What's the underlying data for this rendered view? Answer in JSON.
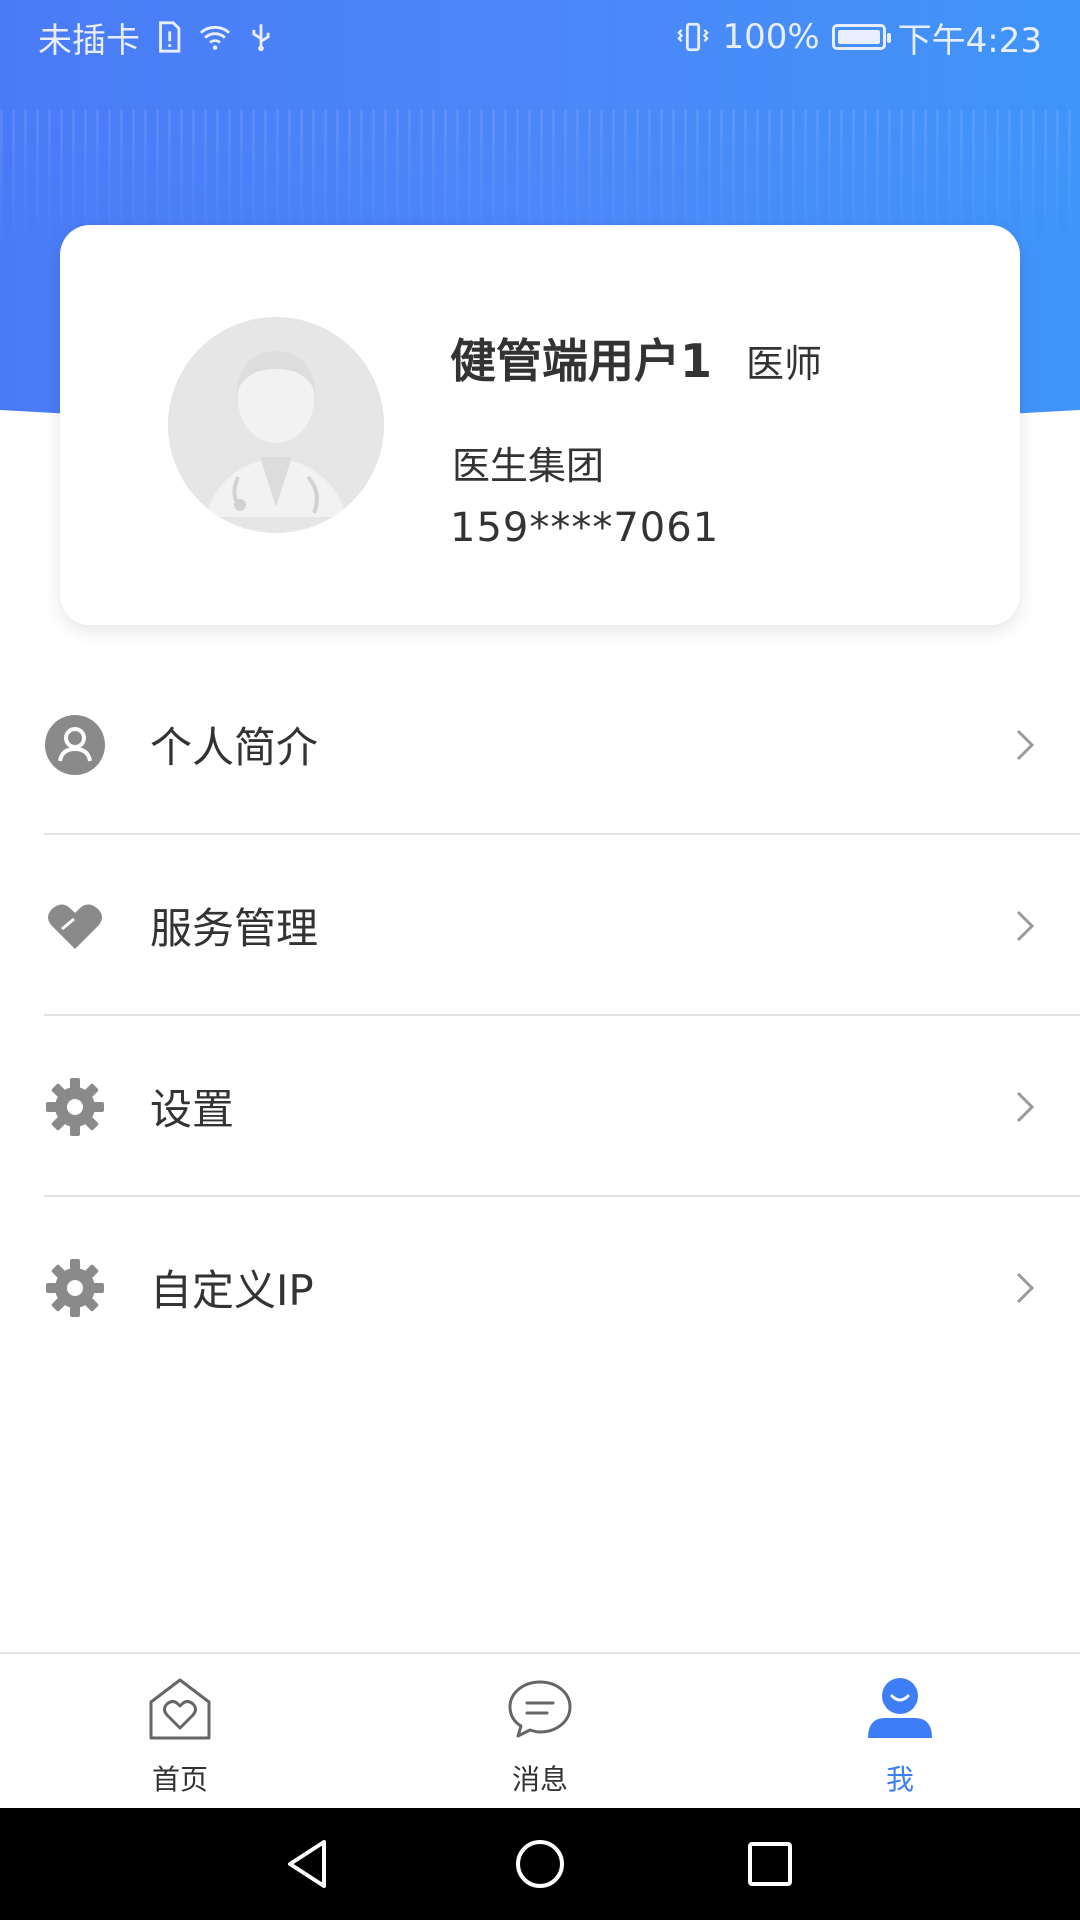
{
  "status_bar": {
    "carrier": "未插卡",
    "battery_percent": "100%",
    "time": "下午4:23"
  },
  "profile": {
    "name": "健管端用户1",
    "role": "医师",
    "organization": "医生集团",
    "phone": "159****7061"
  },
  "menu": {
    "items": [
      {
        "label": "个人简介",
        "icon": "person-icon"
      },
      {
        "label": "服务管理",
        "icon": "heart-icon"
      },
      {
        "label": "设置",
        "icon": "gear-icon"
      },
      {
        "label": "自定义IP",
        "icon": "gear-icon"
      }
    ]
  },
  "tabs": [
    {
      "label": "首页",
      "icon": "home-heart-icon",
      "active": false
    },
    {
      "label": "消息",
      "icon": "chat-bubble-icon",
      "active": false
    },
    {
      "label": "我",
      "icon": "user-profile-icon",
      "active": true
    }
  ],
  "colors": {
    "accent": "#3d7df5",
    "header_gradient_start": "#4a7bf7",
    "header_gradient_end": "#3f95f9",
    "icon_gray": "#8a8a8a"
  }
}
